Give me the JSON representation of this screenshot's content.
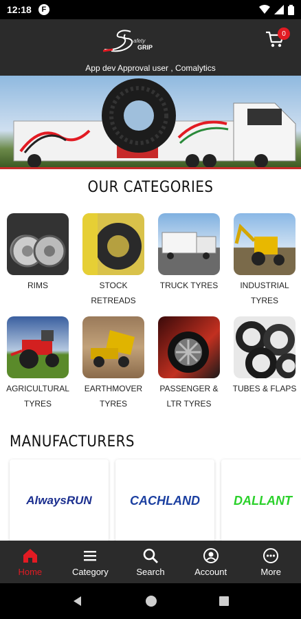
{
  "status_bar": {
    "time": "12:18",
    "notification_app_icon": "F"
  },
  "header": {
    "user_text": "App dev Approval user , Comalytics",
    "cart_count": "0",
    "logo_icon": "safety-grip-logo"
  },
  "banner": {
    "image": "truck-with-tyre-banner"
  },
  "categories": {
    "title": "OUR CATEGORIES",
    "items": [
      {
        "line1": "RIMS",
        "line2": "",
        "icon": "rims-image"
      },
      {
        "line1": "STOCK",
        "line2": "RETREADS",
        "icon": "retreads-image"
      },
      {
        "line1": "TRUCK TYRES",
        "line2": "",
        "icon": "truck-image"
      },
      {
        "line1": "INDUSTRIAL",
        "line2": "TYRES",
        "icon": "backhoe-image"
      },
      {
        "line1": "AGRICULTURAL",
        "line2": "TYRES",
        "icon": "tractor-image"
      },
      {
        "line1": "EARTHMOVER",
        "line2": "TYRES",
        "icon": "dump-truck-image"
      },
      {
        "line1": "PASSENGER &",
        "line2": "LTR TYRES",
        "icon": "car-wheel-image"
      },
      {
        "line1": "TUBES & FLAPS",
        "line2": "",
        "icon": "tubes-image"
      }
    ]
  },
  "manufacturers": {
    "title": "MANUFACTURERS",
    "items": [
      {
        "name": "AlwaysRUN",
        "color": "#1b2f8f"
      },
      {
        "name": "CACHLAND",
        "color": "#1b3fa0"
      },
      {
        "name": "DALLANT",
        "color": "#2bd12b"
      }
    ]
  },
  "bottom_nav": [
    {
      "label": "Home",
      "icon": "home-icon",
      "active": true
    },
    {
      "label": "Category",
      "icon": "menu-icon",
      "active": false
    },
    {
      "label": "Search",
      "icon": "search-icon",
      "active": false
    },
    {
      "label": "Account",
      "icon": "account-icon",
      "active": false
    },
    {
      "label": "More",
      "icon": "more-icon",
      "active": false
    }
  ],
  "colors": {
    "accent": "#e21b23",
    "bar": "#2b2b2b"
  }
}
